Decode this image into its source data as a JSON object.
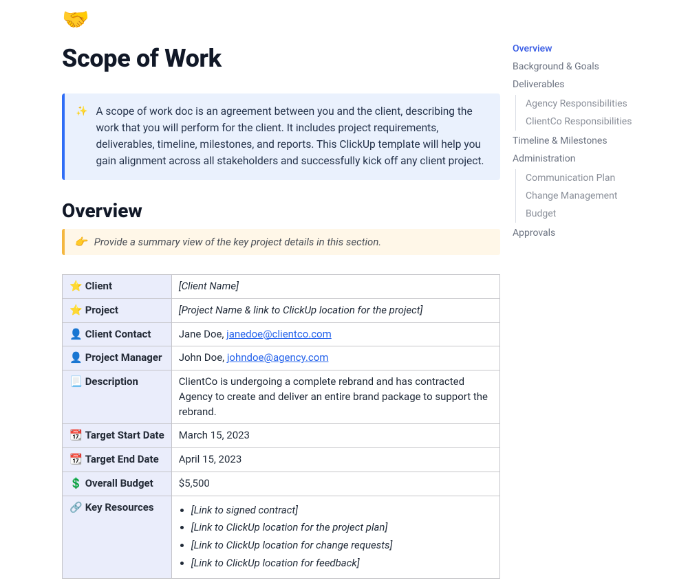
{
  "header": {
    "icon": "🤝",
    "title": "Scope of Work"
  },
  "callout": {
    "icon": "✨",
    "text": "A scope of work doc is an agreement between you and the client, describing the work that you will perform for the client. It includes project requirements, deliverables, timeline, milestones, and reports. This ClickUp template will help you gain alignment across all stakeholders and successfully kick off any client project."
  },
  "overview": {
    "heading": "Overview",
    "hint_icon": "👉",
    "hint_text": "Provide a summary view of the key project details in this section.",
    "rows": {
      "client": {
        "icon": "⭐",
        "label": "Client",
        "value_italic": "[Client Name]"
      },
      "project": {
        "icon": "⭐",
        "label": "Project",
        "value_italic": "[Project Name & link to ClickUp location for the project]"
      },
      "client_contact": {
        "icon": "👤",
        "label": "Client Contact",
        "prefix": "Jane Doe, ",
        "link": "janedoe@clientco.com"
      },
      "pm": {
        "icon": "👤",
        "label": "Project Manager",
        "prefix": "John Doe, ",
        "link": "johndoe@agency.com"
      },
      "description": {
        "icon": "📃",
        "label": "Description",
        "value": "ClientCo is undergoing a complete rebrand and has contracted Agency to create and deliver an entire brand package to support the rebrand."
      },
      "start": {
        "icon": "📆",
        "label": "Target Start Date",
        "value": "March 15, 2023"
      },
      "end": {
        "icon": "📆",
        "label": "Target End Date",
        "value": "April 15, 2023"
      },
      "budget": {
        "icon": "💲",
        "label": "Overall Budget",
        "value": "$5,500"
      },
      "resources": {
        "icon": "🔗",
        "label": "Key Resources",
        "items": [
          "[Link to signed contract]",
          "[Link to ClickUp location for the project plan]",
          "[Link to ClickUp location for change requests]",
          "[Link to ClickUp location for feedback]"
        ]
      }
    }
  },
  "outline": {
    "i0": "Overview",
    "i1": "Background & Goals",
    "i2": "Deliverables",
    "i2a": "Agency Responsibilities",
    "i2b": "ClientCo Responsibilities",
    "i3": "Timeline & Milestones",
    "i4": "Administration",
    "i4a": "Communication Plan",
    "i4b": "Change Management",
    "i4c": "Budget",
    "i5": "Approvals"
  }
}
